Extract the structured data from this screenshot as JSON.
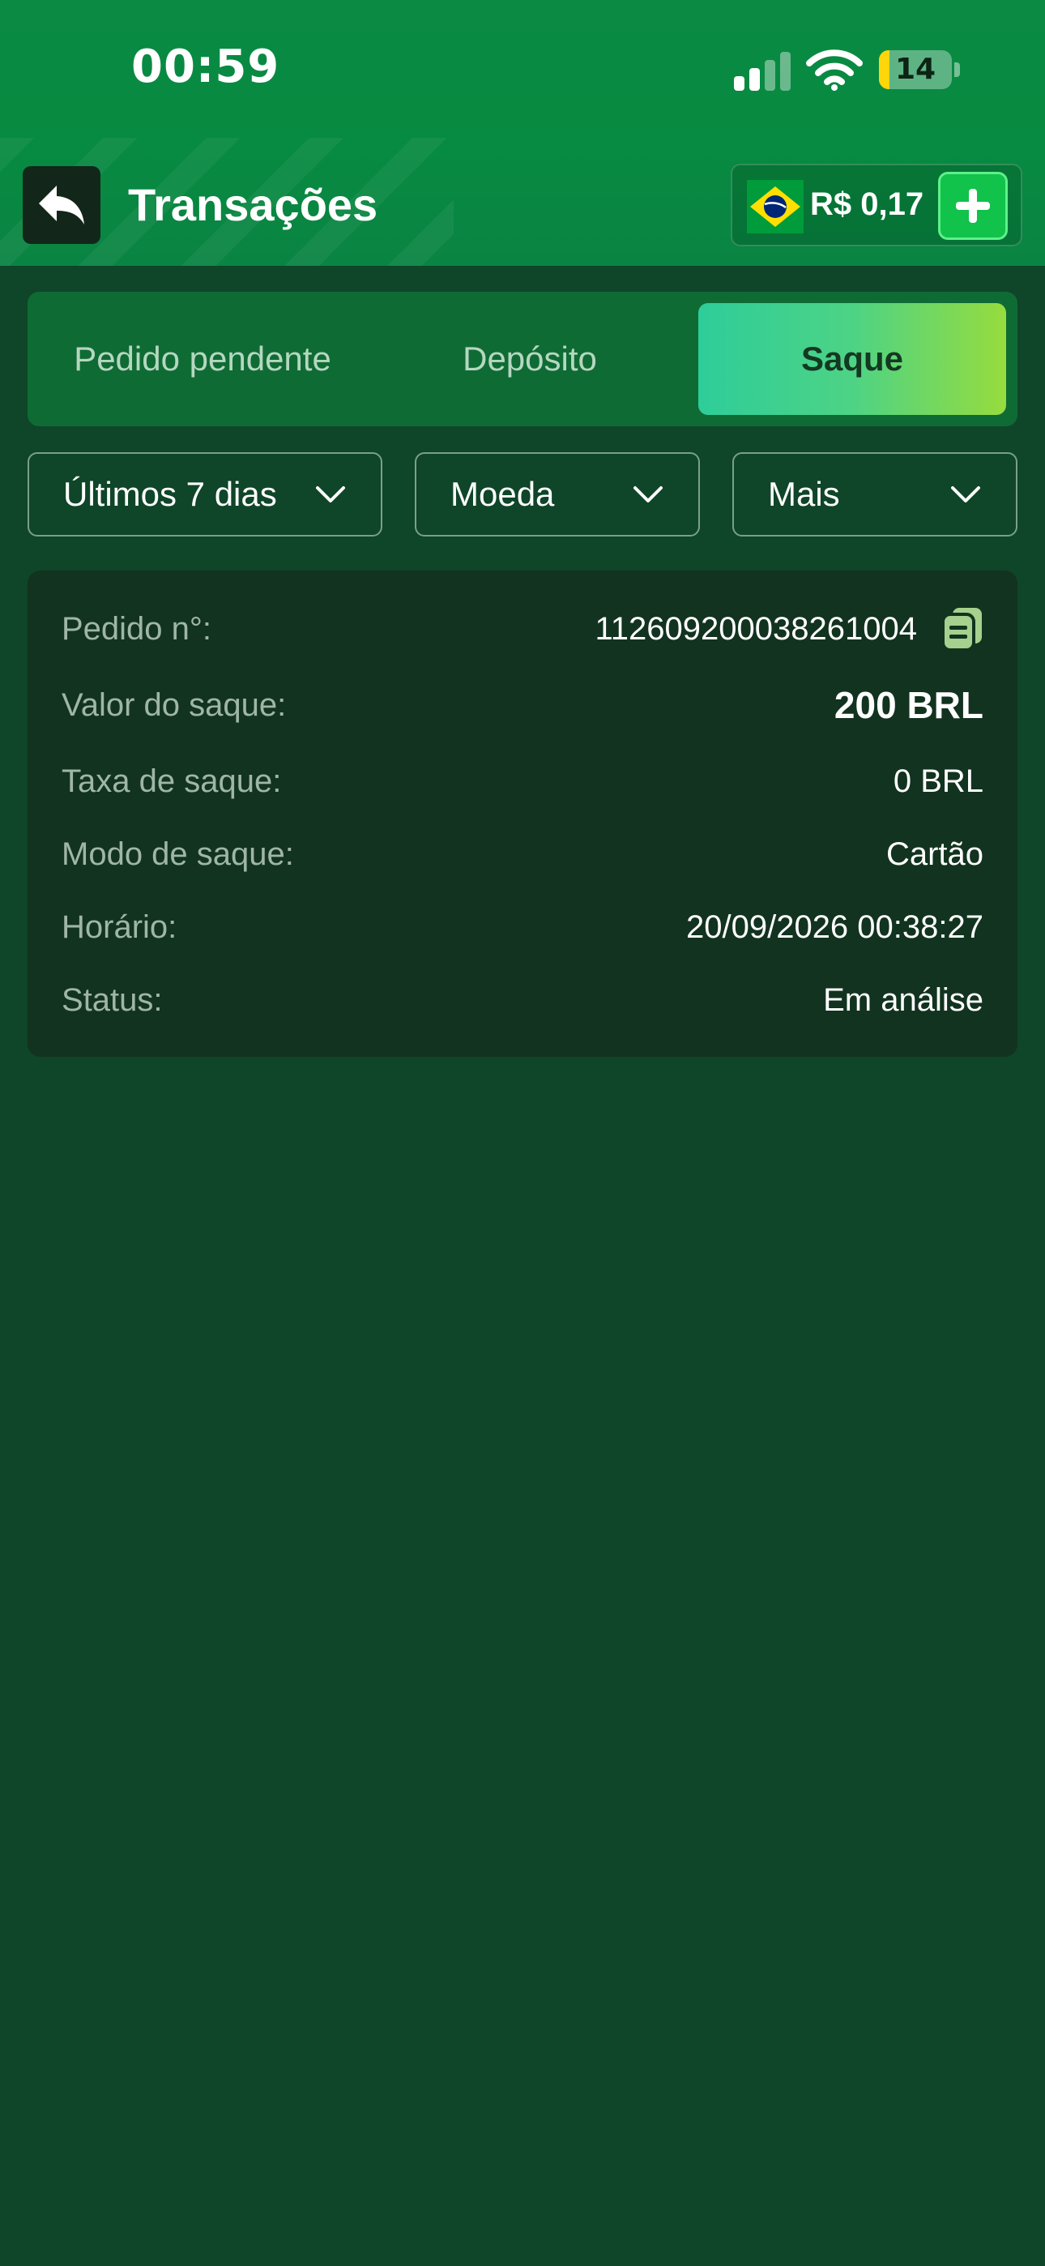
{
  "status_bar": {
    "time": "00:59",
    "battery": "14",
    "battery_level": 0.14
  },
  "header": {
    "title": "Transações",
    "balance": "R$ 0,17"
  },
  "tabs": [
    {
      "label": "Pedido pendente",
      "active": false
    },
    {
      "label": "Depósito",
      "active": false
    },
    {
      "label": "Saque",
      "active": true
    }
  ],
  "filters": [
    {
      "label": "Últimos 7 dias"
    },
    {
      "label": "Moeda"
    },
    {
      "label": "Mais"
    }
  ],
  "record": {
    "order_label": "Pedido n°:",
    "order_value": "1126092000382610​04",
    "amount_label": "Valor do saque:",
    "amount_value": "200 BRL",
    "fee_label": "Taxa de saque:",
    "fee_value": "0 BRL",
    "mode_label": "Modo de saque:",
    "mode_value": "Cartão",
    "time_label": "Horário:",
    "time_value": "20/09/2026 00:38:27",
    "status_label": "Status:",
    "status_value": "Em análise"
  },
  "colors": {
    "background": "#0f4528",
    "header": "#078a41",
    "accent_green": "#11c24b",
    "card": "#12331f"
  },
  "icons": {
    "back": "back-arrow-icon",
    "flag": "brazil-flag-icon",
    "add": "plus-icon",
    "chevron": "chevron-down-icon",
    "copy": "copy-icon"
  }
}
